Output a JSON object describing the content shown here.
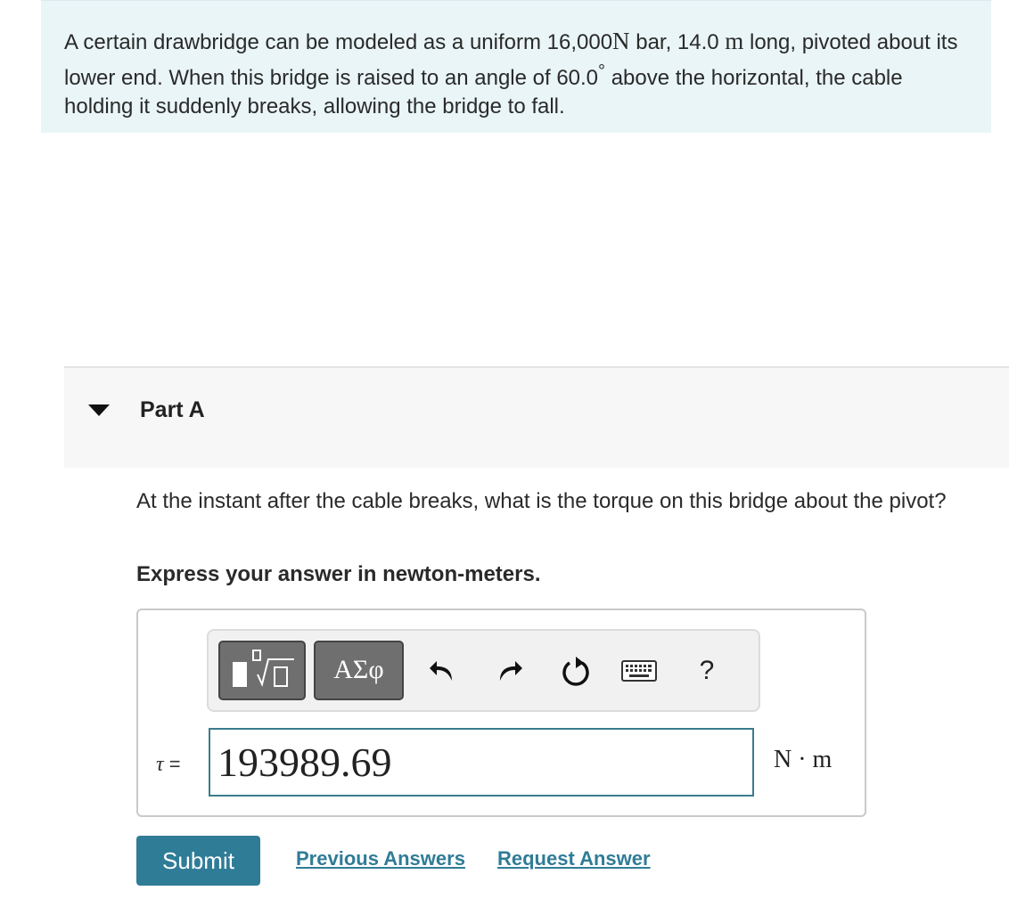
{
  "problem": {
    "text_1": "A certain drawbridge can be modeled as a uniform 16,000",
    "unit_newton": "N",
    "text_2": " bar, 14.0 ",
    "unit_meter": "m",
    "text_3": " long, pivoted about its lower end. When this bridge is raised to an angle of 60.0",
    "degree": "°",
    "text_4": " above the horizontal, the cable holding it suddenly breaks, allowing the bridge to fall."
  },
  "part": {
    "title": "Part A",
    "question": "At the instant after the cable breaks, what is the torque on this bridge about the pivot?",
    "instruction": "Express your answer in newton-meters."
  },
  "toolbar": {
    "greek_label": "ΑΣφ",
    "help_label": "?"
  },
  "answer": {
    "symbol": "τ",
    "equals": " =",
    "value": "193989.69",
    "units": "N · m"
  },
  "actions": {
    "submit_label": "Submit",
    "previous_answers_label": "Previous Answers",
    "request_answer_label": "Request Answer"
  },
  "colors": {
    "problem_bg": "#e9f5f7",
    "accent": "#2f7c97"
  }
}
